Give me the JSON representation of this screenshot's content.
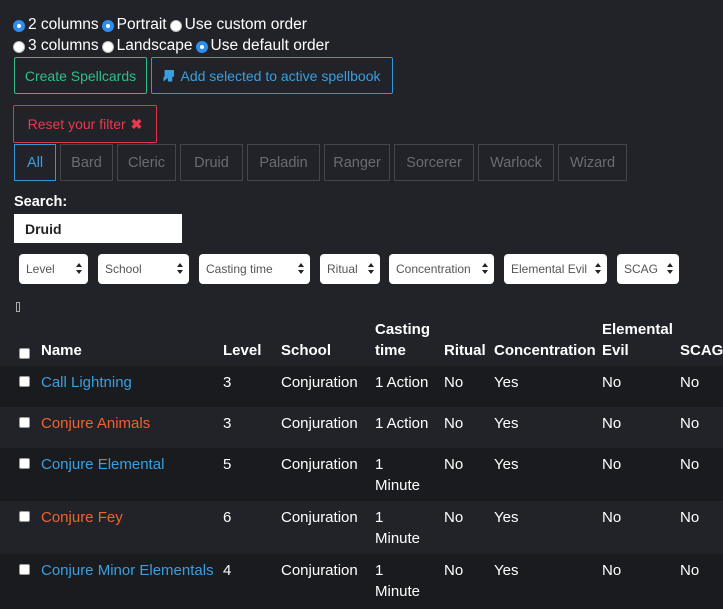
{
  "layout_opts": {
    "two_columns": "2 columns",
    "three_columns": "3 columns",
    "portrait": "Portrait",
    "landscape": "Landscape",
    "custom_order": "Use custom order",
    "default_order": "Use default order"
  },
  "buttons": {
    "create": "Create Spellcards",
    "add_selected": "Add selected to active spellbook",
    "reset": "Reset your filter"
  },
  "classes": [
    "All",
    "Bard",
    "Cleric",
    "Druid",
    "Paladin",
    "Ranger",
    "Sorcerer",
    "Warlock",
    "Wizard"
  ],
  "search": {
    "label": "Search:",
    "value": "Druid"
  },
  "filters": [
    "Level",
    "School",
    "Casting time",
    "Ritual",
    "Concentration",
    "Elemental Evil",
    "SCAG"
  ],
  "table": {
    "headers": {
      "name": "Name",
      "level": "Level",
      "school": "School",
      "casting_1": "Casting",
      "casting_2": "time",
      "ritual": "Ritual",
      "concentration": "Concentration",
      "elemental_1": "Elemental",
      "elemental_2": "Evil",
      "scag": "SCAG"
    },
    "rows": [
      {
        "name": "Call Lightning",
        "level": "3",
        "school": "Conjuration",
        "time_1": "1 Action",
        "time_2": "",
        "ritual": "No",
        "concentration": "Yes",
        "elemental": "No",
        "scag": "No"
      },
      {
        "name": "Conjure Animals",
        "level": "3",
        "school": "Conjuration",
        "time_1": "1 Action",
        "time_2": "",
        "ritual": "No",
        "concentration": "Yes",
        "elemental": "No",
        "scag": "No"
      },
      {
        "name": "Conjure Elemental",
        "level": "5",
        "school": "Conjuration",
        "time_1": "1",
        "time_2": "Minute",
        "ritual": "No",
        "concentration": "Yes",
        "elemental": "No",
        "scag": "No"
      },
      {
        "name": "Conjure Fey",
        "level": "6",
        "school": "Conjuration",
        "time_1": "1",
        "time_2": "Minute",
        "ritual": "No",
        "concentration": "Yes",
        "elemental": "No",
        "scag": "No"
      },
      {
        "name": "Conjure Minor Elementals",
        "level": "4",
        "school": "Conjuration",
        "time_1": "1",
        "time_2": "Minute",
        "ritual": "No",
        "concentration": "Yes",
        "elemental": "No",
        "scag": "No"
      }
    ]
  },
  "colors": {
    "background": "#222329",
    "row_alt": "#1a1b1f",
    "blue_link": "#3a9fe0",
    "orange_link": "#f0622d",
    "green": "#2fbe88",
    "red": "#e8394e"
  }
}
